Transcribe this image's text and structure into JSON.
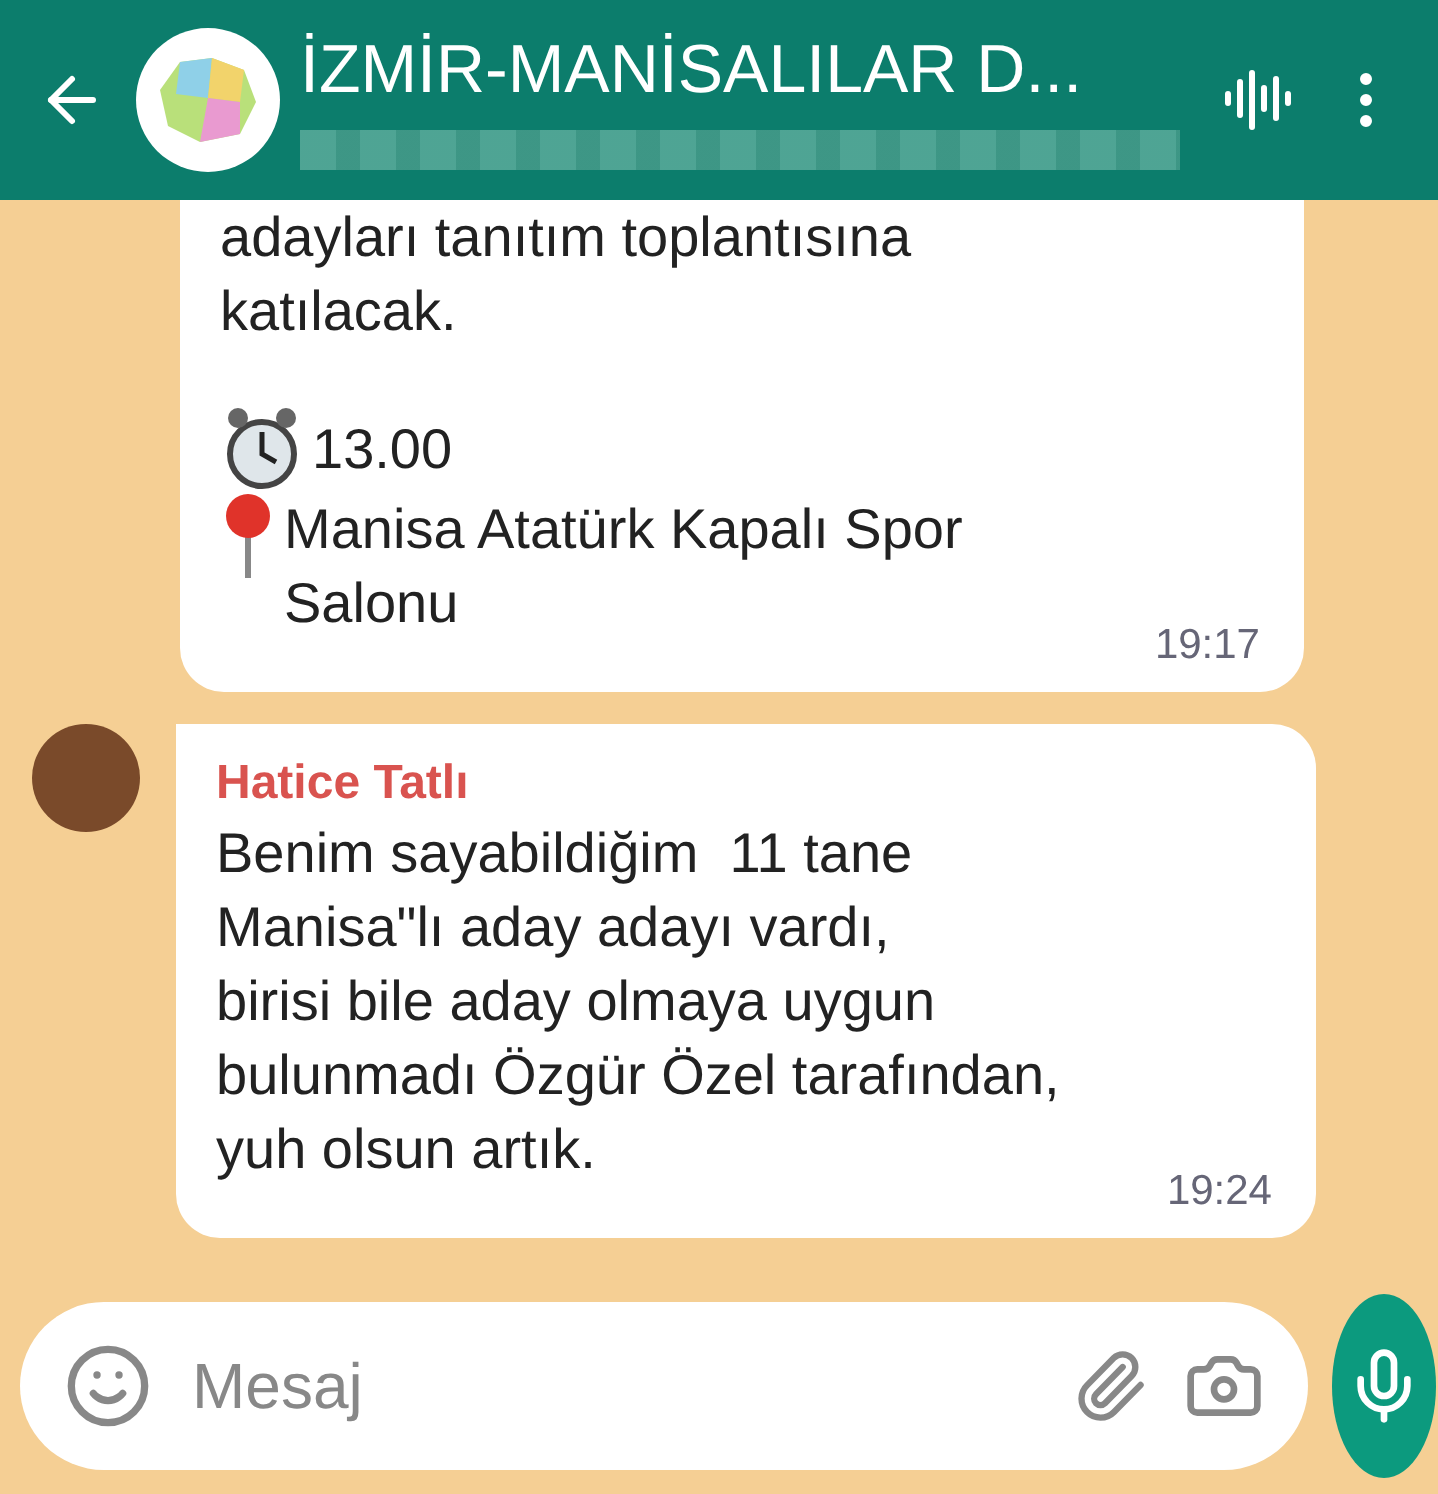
{
  "header": {
    "title": "İZMİR-MANİSALILAR D..."
  },
  "messages": [
    {
      "paragraphs": [
        {
          "kind": "text",
          "lines": [
            "adayları tanıtım toplantısına",
            "katılacak."
          ]
        },
        {
          "kind": "gap"
        },
        {
          "kind": "clock",
          "lines": [
            "13.00"
          ]
        },
        {
          "kind": "pin",
          "lines": [
            "Manisa Atatürk Kapalı Spor",
            "Salonu"
          ]
        }
      ],
      "time": "19:17"
    },
    {
      "sender": "Hatice Tatlı",
      "color": "#d9534f",
      "paragraphs": [
        {
          "kind": "text",
          "lines": [
            "Benim sayabildiğim  11 tane",
            "Manisa\"lı aday adayı vardı,",
            "birisi bile aday olmaya uygun",
            "bulunmadı Özgür Özel tarafından,",
            "yuh olsun artık."
          ]
        }
      ],
      "time": "19:24"
    }
  ],
  "composer": {
    "placeholder": "Mesaj"
  }
}
